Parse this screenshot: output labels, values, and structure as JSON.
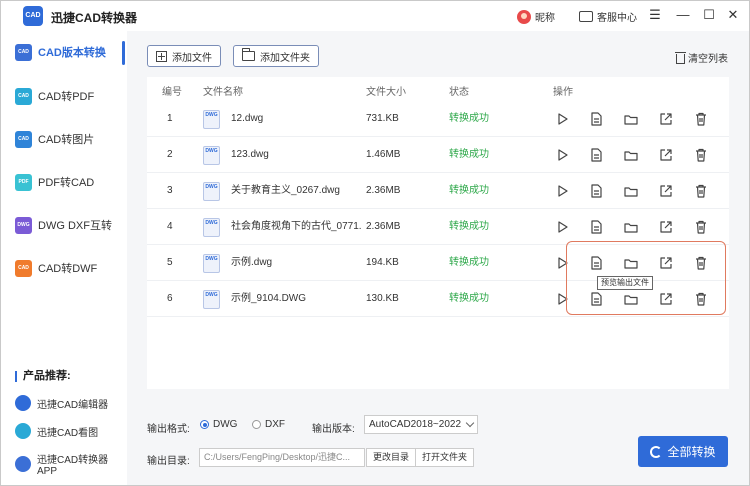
{
  "app": {
    "title": "迅捷CAD转换器",
    "logo_text": "CAD"
  },
  "titlebar": {
    "user_label": "昵称",
    "service_label": "客服中心",
    "minimize": "—",
    "maximize": "☐",
    "close": "✕"
  },
  "sidebar": {
    "items": [
      {
        "label": "CAD版本转换",
        "icon_text": "CAD",
        "color": "#3b6fd6"
      },
      {
        "label": "CAD转PDF",
        "icon_text": "CAD",
        "color": "#2aa9d6"
      },
      {
        "label": "CAD转图片",
        "icon_text": "CAD",
        "color": "#2f84d8"
      },
      {
        "label": "PDF转CAD",
        "icon_text": "PDF",
        "color": "#39c2d3"
      },
      {
        "label": "DWG DXF互转",
        "icon_text": "DWG",
        "color": "#7b5bd6"
      },
      {
        "label": "CAD转DWF",
        "icon_text": "CAD",
        "color": "#f07b2c"
      }
    ],
    "recommend_title": "产品推荐:",
    "recommend": [
      {
        "label": "迅捷CAD编辑器",
        "color": "#2f6bd8"
      },
      {
        "label": "迅捷CAD看图",
        "color": "#2aa9d6"
      },
      {
        "label": "迅捷CAD转换器APP",
        "color": "#3b6fd6"
      }
    ]
  },
  "toolbar": {
    "add_file": "添加文件",
    "add_folder": "添加文件夹",
    "clear_list": "清空列表"
  },
  "table": {
    "headers": {
      "index": "编号",
      "name": "文件名称",
      "size": "文件大小",
      "status": "状态",
      "actions": "操作"
    },
    "icon_text": "DWG",
    "rows": [
      {
        "index": "1",
        "name": "12.dwg",
        "size": "731.KB",
        "status": "转换成功"
      },
      {
        "index": "2",
        "name": "123.dwg",
        "size": "1.46MB",
        "status": "转换成功"
      },
      {
        "index": "3",
        "name": "关于教育主义_0267.dwg",
        "size": "2.36MB",
        "status": "转换成功"
      },
      {
        "index": "4",
        "name": "社会角度视角下的古代_0771...",
        "size": "2.36MB",
        "status": "转换成功"
      },
      {
        "index": "5",
        "name": "示例.dwg",
        "size": "194.KB",
        "status": "转换成功"
      },
      {
        "index": "6",
        "name": "示例_9104.DWG",
        "size": "130.KB",
        "status": "转换成功"
      }
    ],
    "tooltip": "预览输出文件"
  },
  "output": {
    "format_label": "输出格式:",
    "formats": [
      "DWG",
      "DXF"
    ],
    "selected_format": "DWG",
    "version_label": "输出版本:",
    "version_value": "AutoCAD2018~2022",
    "dir_label": "输出目录:",
    "dir_value": "C:/Users/FengPing/Desktop/迅捷C...",
    "change_dir": "更改目录",
    "open_folder": "打开文件夹",
    "convert_all": "全部转换"
  }
}
